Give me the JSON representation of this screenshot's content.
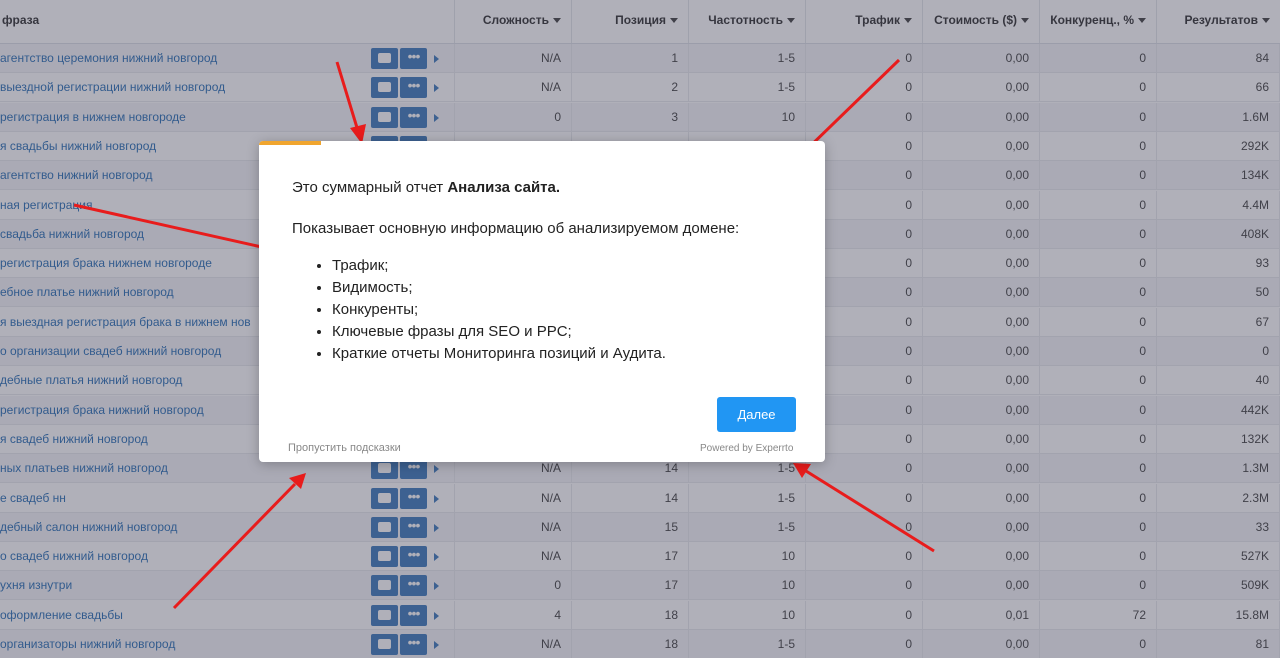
{
  "table": {
    "headers": {
      "phrase": "фраза",
      "difficulty": "Сложность",
      "position": "Позиция",
      "frequency": "Частотность",
      "traffic": "Трафик",
      "cost": "Стоимость ($)",
      "competition": "Конкуренц., %",
      "results": "Результатов"
    },
    "rows": [
      {
        "kw": "агентство церемония нижний новгород",
        "diff": "N/A",
        "pos": "1",
        "freq": "1-5",
        "traffic": "0",
        "cost": "0,00",
        "comp": "0",
        "res": "84"
      },
      {
        "kw": "выездной регистрации нижний новгород",
        "diff": "N/A",
        "pos": "2",
        "freq": "1-5",
        "traffic": "0",
        "cost": "0,00",
        "comp": "0",
        "res": "66"
      },
      {
        "kw": "регистрация в нижнем новгороде",
        "diff": "0",
        "pos": "3",
        "freq": "10",
        "traffic": "0",
        "cost": "0,00",
        "comp": "0",
        "res": "1.6M"
      },
      {
        "kw": "я свадьбы нижний новгород",
        "diff": "",
        "pos": "",
        "freq": "",
        "traffic": "0",
        "cost": "0,00",
        "comp": "0",
        "res": "292K"
      },
      {
        "kw": "агентство нижний новгород",
        "diff": "",
        "pos": "",
        "freq": "",
        "traffic": "0",
        "cost": "0,00",
        "comp": "0",
        "res": "134K"
      },
      {
        "kw": "ная регистрация",
        "diff": "",
        "pos": "",
        "freq": "",
        "traffic": "0",
        "cost": "0,00",
        "comp": "0",
        "res": "4.4M"
      },
      {
        "kw": "свадьба нижний новгород",
        "diff": "",
        "pos": "",
        "freq": "",
        "traffic": "0",
        "cost": "0,00",
        "comp": "0",
        "res": "408K"
      },
      {
        "kw": "регистрация брака нижнем новгороде",
        "diff": "",
        "pos": "",
        "freq": "",
        "traffic": "0",
        "cost": "0,00",
        "comp": "0",
        "res": "93"
      },
      {
        "kw": "ебное платье нижний новгород",
        "diff": "",
        "pos": "",
        "freq": "",
        "traffic": "0",
        "cost": "0,00",
        "comp": "0",
        "res": "50"
      },
      {
        "kw": "я выездная регистрация брака в нижнем нов",
        "diff": "",
        "pos": "",
        "freq": "",
        "traffic": "0",
        "cost": "0,00",
        "comp": "0",
        "res": "67"
      },
      {
        "kw": "о организации свадеб нижний новгород",
        "diff": "",
        "pos": "",
        "freq": "",
        "traffic": "0",
        "cost": "0,00",
        "comp": "0",
        "res": "0"
      },
      {
        "kw": "дебные платья нижний новгород",
        "diff": "",
        "pos": "",
        "freq": "",
        "traffic": "0",
        "cost": "0,00",
        "comp": "0",
        "res": "40"
      },
      {
        "kw": "регистрация брака нижний новгород",
        "diff": "",
        "pos": "",
        "freq": "",
        "traffic": "0",
        "cost": "0,00",
        "comp": "0",
        "res": "442K"
      },
      {
        "kw": "я свадеб нижний новгород",
        "diff": "",
        "pos": "",
        "freq": "",
        "traffic": "0",
        "cost": "0,00",
        "comp": "0",
        "res": "132K"
      },
      {
        "kw": "ных платьев нижний новгород",
        "diff": "N/A",
        "pos": "14",
        "freq": "1-5",
        "traffic": "0",
        "cost": "0,00",
        "comp": "0",
        "res": "1.3M"
      },
      {
        "kw": "е свадеб нн",
        "diff": "N/A",
        "pos": "14",
        "freq": "1-5",
        "traffic": "0",
        "cost": "0,00",
        "comp": "0",
        "res": "2.3M"
      },
      {
        "kw": "дебный салон нижний новгород",
        "diff": "N/A",
        "pos": "15",
        "freq": "1-5",
        "traffic": "0",
        "cost": "0,00",
        "comp": "0",
        "res": "33"
      },
      {
        "kw": "о свадеб нижний новгород",
        "diff": "N/A",
        "pos": "17",
        "freq": "10",
        "traffic": "0",
        "cost": "0,00",
        "comp": "0",
        "res": "527K"
      },
      {
        "kw": "ухня изнутри",
        "diff": "0",
        "pos": "17",
        "freq": "10",
        "traffic": "0",
        "cost": "0,00",
        "comp": "0",
        "res": "509K"
      },
      {
        "kw": "оформление свадьбы",
        "diff": "4",
        "pos": "18",
        "freq": "10",
        "traffic": "0",
        "cost": "0,01",
        "comp": "72",
        "res": "15.8M"
      },
      {
        "kw": "организаторы нижний новгород",
        "diff": "N/A",
        "pos": "18",
        "freq": "1-5",
        "traffic": "0",
        "cost": "0,00",
        "comp": "0",
        "res": "81"
      }
    ]
  },
  "modal": {
    "title_prefix": "Это суммарный отчет ",
    "title_bold": "Анализа сайта.",
    "description": "Показывает основную информацию об анализируемом домене:",
    "items": [
      "Трафик;",
      "Видимость;",
      "Конкуренты;",
      "Ключевые фразы для SEO и PPC;",
      "Краткие отчеты Мониторинга позиций и Аудита."
    ],
    "next_label": "Далее",
    "skip_label": "Пропустить подсказки",
    "powered_label": "Powered by Experrto"
  },
  "colors": {
    "accent": "#2196f3",
    "keyword_link": "#1a64b0",
    "progress_bar": "#f0a52e",
    "annotation_arrow": "#e81c1c"
  }
}
